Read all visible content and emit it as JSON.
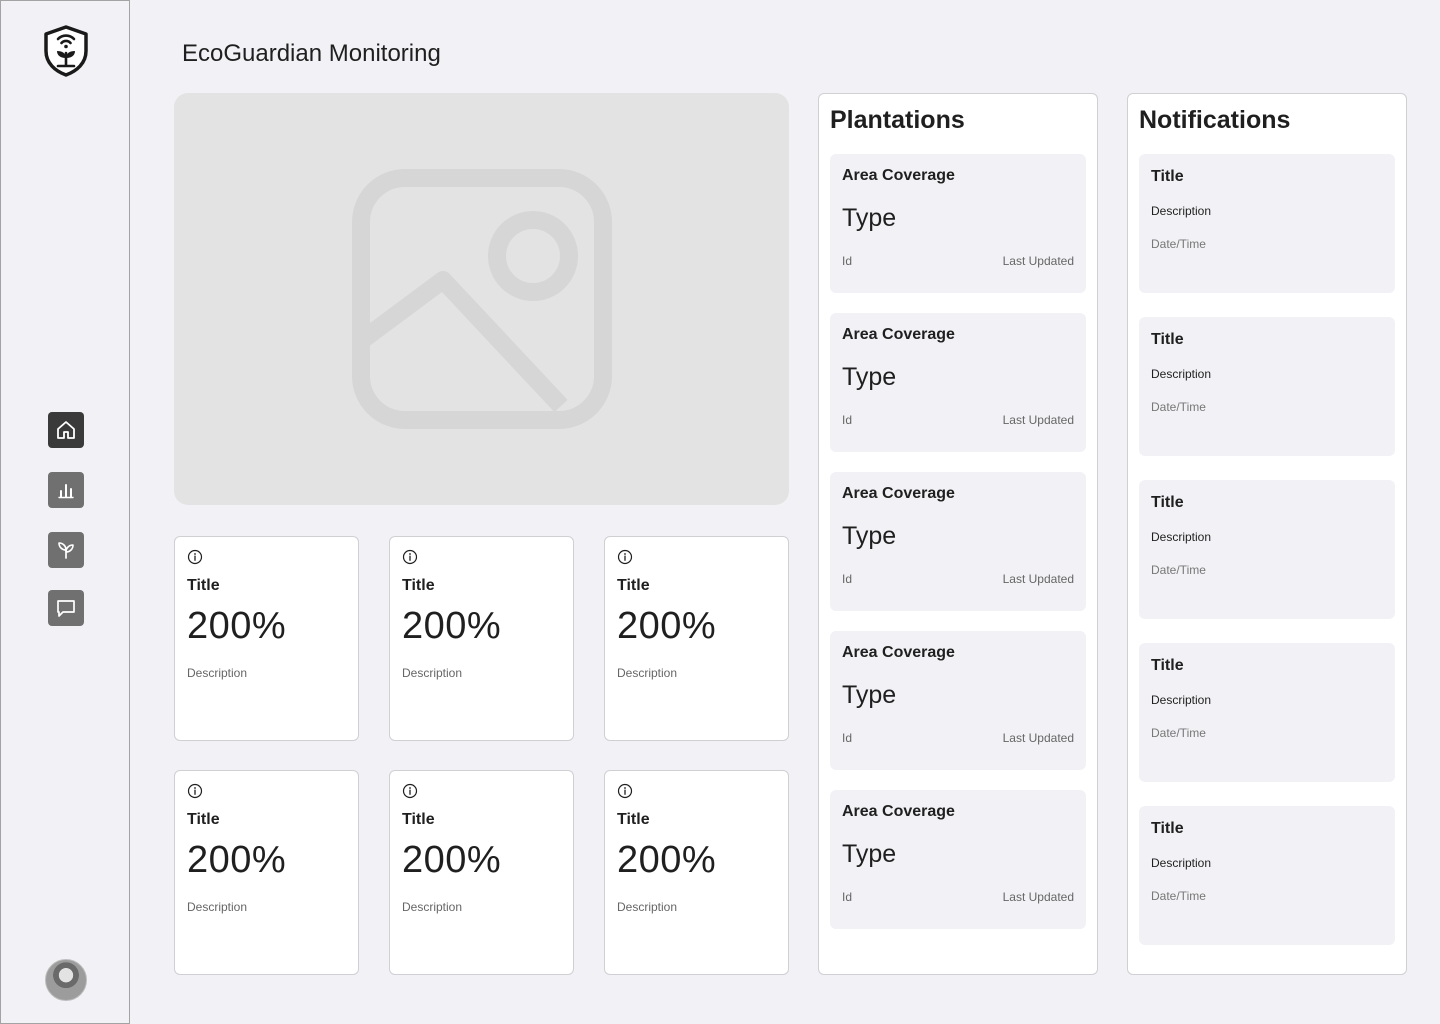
{
  "app": {
    "title": "EcoGuardian Monitoring"
  },
  "sidebar": {
    "logo_icon": "shield-plant-wifi-icon",
    "nav": [
      {
        "id": "home",
        "icon": "home-icon",
        "active": true
      },
      {
        "id": "analytics",
        "icon": "bar-chart-icon",
        "active": false
      },
      {
        "id": "plants",
        "icon": "sprout-icon",
        "active": false
      },
      {
        "id": "messages",
        "icon": "chat-icon",
        "active": false
      }
    ],
    "avatar": "user-avatar"
  },
  "hero": {
    "icon": "image-placeholder-icon"
  },
  "stats": [
    {
      "title": "Title",
      "value": "200%",
      "description": "Description",
      "icon": "info-icon"
    },
    {
      "title": "Title",
      "value": "200%",
      "description": "Description",
      "icon": "info-icon"
    },
    {
      "title": "Title",
      "value": "200%",
      "description": "Description",
      "icon": "info-icon"
    },
    {
      "title": "Title",
      "value": "200%",
      "description": "Description",
      "icon": "info-icon"
    },
    {
      "title": "Title",
      "value": "200%",
      "description": "Description",
      "icon": "info-icon"
    },
    {
      "title": "Title",
      "value": "200%",
      "description": "Description",
      "icon": "info-icon"
    }
  ],
  "plantations": {
    "title": "Plantations",
    "items": [
      {
        "area": "Area Coverage",
        "type": "Type",
        "id": "Id",
        "updated": "Last Updated"
      },
      {
        "area": "Area Coverage",
        "type": "Type",
        "id": "Id",
        "updated": "Last Updated"
      },
      {
        "area": "Area Coverage",
        "type": "Type",
        "id": "Id",
        "updated": "Last Updated"
      },
      {
        "area": "Area Coverage",
        "type": "Type",
        "id": "Id",
        "updated": "Last Updated"
      },
      {
        "area": "Area Coverage",
        "type": "Type",
        "id": "Id",
        "updated": "Last Updated"
      }
    ]
  },
  "notifications": {
    "title": "Notifications",
    "items": [
      {
        "title": "Title",
        "description": "Description",
        "datetime": "Date/Time"
      },
      {
        "title": "Title",
        "description": "Description",
        "datetime": "Date/Time"
      },
      {
        "title": "Title",
        "description": "Description",
        "datetime": "Date/Time"
      },
      {
        "title": "Title",
        "description": "Description",
        "datetime": "Date/Time"
      },
      {
        "title": "Title",
        "description": "Description",
        "datetime": "Date/Time"
      }
    ]
  },
  "colors": {
    "background": "#f2f2f6",
    "card": "#ffffff",
    "nav_active": "#3a3a3a",
    "nav_inactive": "#707070",
    "placeholder": "#e3e3e3"
  }
}
